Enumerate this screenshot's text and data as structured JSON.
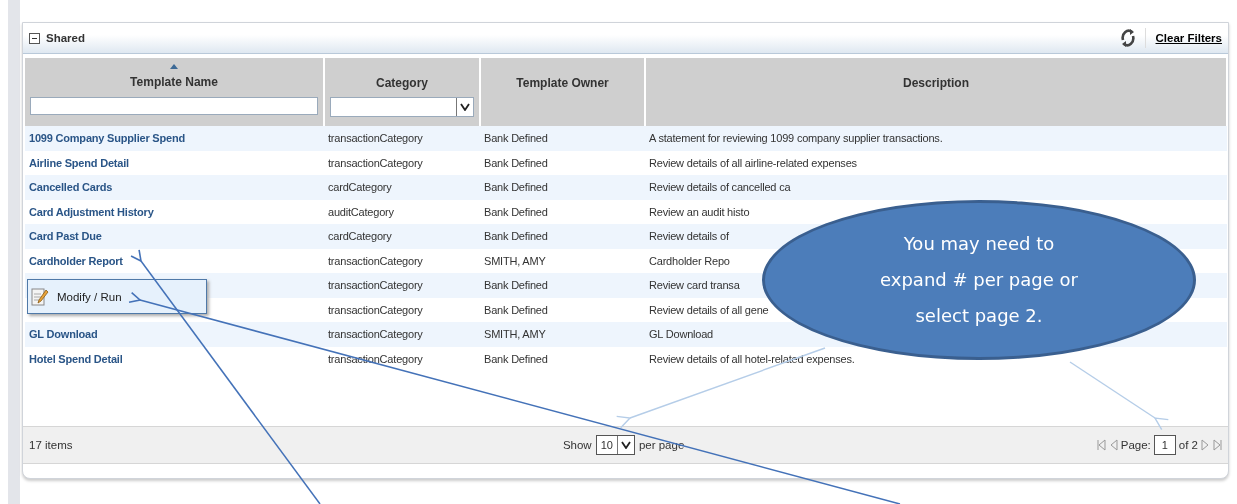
{
  "panel": {
    "title": "Shared",
    "expanded": true,
    "clear_filters": "Clear Filters"
  },
  "table": {
    "columns": [
      {
        "label": "Template Name",
        "sorted": true,
        "kind": "text"
      },
      {
        "label": "Category",
        "sorted": false,
        "kind": "select"
      },
      {
        "label": "Template Owner",
        "sorted": false,
        "kind": "plain"
      },
      {
        "label": "Description",
        "sorted": false,
        "kind": "plain"
      }
    ],
    "rows": [
      {
        "name": "1099 Company Supplier Spend",
        "category": "transactionCategory",
        "owner": "Bank Defined",
        "description": "A statement for reviewing 1099 company supplier transactions."
      },
      {
        "name": "Airline Spend Detail",
        "category": "transactionCategory",
        "owner": "Bank Defined",
        "description": "Review details of all airline-related expenses"
      },
      {
        "name": "Cancelled Cards",
        "category": "cardCategory",
        "owner": "Bank Defined",
        "description": "Review details of cancelled ca"
      },
      {
        "name": "Card Adjustment History",
        "category": "auditCategory",
        "owner": "Bank Defined",
        "description": "Review an audit histo"
      },
      {
        "name": "Card Past Due",
        "category": "cardCategory",
        "owner": "Bank Defined",
        "description": "Review details of"
      },
      {
        "name": "Cardholder Report",
        "category": "transactionCategory",
        "owner": "SMITH, AMY",
        "description": "Cardholder Repo"
      },
      {
        "name": "",
        "category": "transactionCategory",
        "owner": "Bank Defined",
        "description": "Review card transa"
      },
      {
        "name": "",
        "category": "transactionCategory",
        "owner": "Bank Defined",
        "description": "Review details of all gene"
      },
      {
        "name": "GL Download",
        "category": "transactionCategory",
        "owner": "SMITH, AMY",
        "description": "GL Download"
      },
      {
        "name": "Hotel Spend Detail",
        "category": "transactionCategory",
        "owner": "Bank Defined",
        "description": "Review details of all hotel-related expenses."
      }
    ]
  },
  "context_menu": {
    "items": [
      "Modify / Run"
    ]
  },
  "footer": {
    "count": "17 items",
    "show": "Show",
    "per_page_value": "10",
    "per_page": "per page",
    "page_label": "Page:",
    "page_value": "1",
    "page_total": "of 2"
  },
  "callout": {
    "text": "You may need to expand # per page or select page 2."
  }
}
